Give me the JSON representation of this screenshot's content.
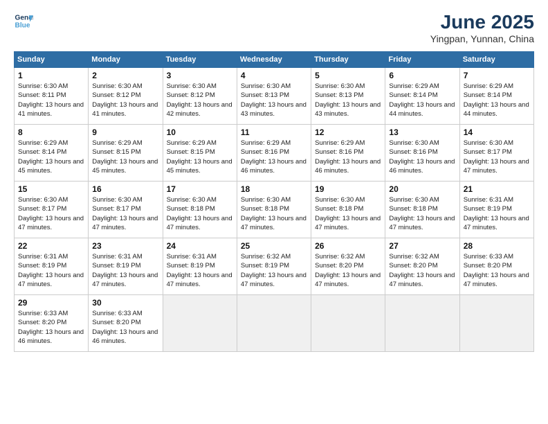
{
  "header": {
    "logo_line1": "General",
    "logo_line2": "Blue",
    "main_title": "June 2025",
    "subtitle": "Yingpan, Yunnan, China"
  },
  "calendar": {
    "days_of_week": [
      "Sunday",
      "Monday",
      "Tuesday",
      "Wednesday",
      "Thursday",
      "Friday",
      "Saturday"
    ],
    "weeks": [
      [
        null,
        null,
        null,
        null,
        null,
        null,
        null
      ]
    ],
    "cells": [
      {
        "day": 1,
        "sunrise": "6:30 AM",
        "sunset": "8:11 PM",
        "daylight": "13 hours and 41 minutes."
      },
      {
        "day": 2,
        "sunrise": "6:30 AM",
        "sunset": "8:12 PM",
        "daylight": "13 hours and 41 minutes."
      },
      {
        "day": 3,
        "sunrise": "6:30 AM",
        "sunset": "8:12 PM",
        "daylight": "13 hours and 42 minutes."
      },
      {
        "day": 4,
        "sunrise": "6:30 AM",
        "sunset": "8:13 PM",
        "daylight": "13 hours and 43 minutes."
      },
      {
        "day": 5,
        "sunrise": "6:30 AM",
        "sunset": "8:13 PM",
        "daylight": "13 hours and 43 minutes."
      },
      {
        "day": 6,
        "sunrise": "6:29 AM",
        "sunset": "8:14 PM",
        "daylight": "13 hours and 44 minutes."
      },
      {
        "day": 7,
        "sunrise": "6:29 AM",
        "sunset": "8:14 PM",
        "daylight": "13 hours and 44 minutes."
      },
      {
        "day": 8,
        "sunrise": "6:29 AM",
        "sunset": "8:14 PM",
        "daylight": "13 hours and 45 minutes."
      },
      {
        "day": 9,
        "sunrise": "6:29 AM",
        "sunset": "8:15 PM",
        "daylight": "13 hours and 45 minutes."
      },
      {
        "day": 10,
        "sunrise": "6:29 AM",
        "sunset": "8:15 PM",
        "daylight": "13 hours and 45 minutes."
      },
      {
        "day": 11,
        "sunrise": "6:29 AM",
        "sunset": "8:16 PM",
        "daylight": "13 hours and 46 minutes."
      },
      {
        "day": 12,
        "sunrise": "6:29 AM",
        "sunset": "8:16 PM",
        "daylight": "13 hours and 46 minutes."
      },
      {
        "day": 13,
        "sunrise": "6:30 AM",
        "sunset": "8:16 PM",
        "daylight": "13 hours and 46 minutes."
      },
      {
        "day": 14,
        "sunrise": "6:30 AM",
        "sunset": "8:17 PM",
        "daylight": "13 hours and 47 minutes."
      },
      {
        "day": 15,
        "sunrise": "6:30 AM",
        "sunset": "8:17 PM",
        "daylight": "13 hours and 47 minutes."
      },
      {
        "day": 16,
        "sunrise": "6:30 AM",
        "sunset": "8:17 PM",
        "daylight": "13 hours and 47 minutes."
      },
      {
        "day": 17,
        "sunrise": "6:30 AM",
        "sunset": "8:18 PM",
        "daylight": "13 hours and 47 minutes."
      },
      {
        "day": 18,
        "sunrise": "6:30 AM",
        "sunset": "8:18 PM",
        "daylight": "13 hours and 47 minutes."
      },
      {
        "day": 19,
        "sunrise": "6:30 AM",
        "sunset": "8:18 PM",
        "daylight": "13 hours and 47 minutes."
      },
      {
        "day": 20,
        "sunrise": "6:30 AM",
        "sunset": "8:18 PM",
        "daylight": "13 hours and 47 minutes."
      },
      {
        "day": 21,
        "sunrise": "6:31 AM",
        "sunset": "8:19 PM",
        "daylight": "13 hours and 47 minutes."
      },
      {
        "day": 22,
        "sunrise": "6:31 AM",
        "sunset": "8:19 PM",
        "daylight": "13 hours and 47 minutes."
      },
      {
        "day": 23,
        "sunrise": "6:31 AM",
        "sunset": "8:19 PM",
        "daylight": "13 hours and 47 minutes."
      },
      {
        "day": 24,
        "sunrise": "6:31 AM",
        "sunset": "8:19 PM",
        "daylight": "13 hours and 47 minutes."
      },
      {
        "day": 25,
        "sunrise": "6:32 AM",
        "sunset": "8:19 PM",
        "daylight": "13 hours and 47 minutes."
      },
      {
        "day": 26,
        "sunrise": "6:32 AM",
        "sunset": "8:20 PM",
        "daylight": "13 hours and 47 minutes."
      },
      {
        "day": 27,
        "sunrise": "6:32 AM",
        "sunset": "8:20 PM",
        "daylight": "13 hours and 47 minutes."
      },
      {
        "day": 28,
        "sunrise": "6:33 AM",
        "sunset": "8:20 PM",
        "daylight": "13 hours and 47 minutes."
      },
      {
        "day": 29,
        "sunrise": "6:33 AM",
        "sunset": "8:20 PM",
        "daylight": "13 hours and 46 minutes."
      },
      {
        "day": 30,
        "sunrise": "6:33 AM",
        "sunset": "8:20 PM",
        "daylight": "13 hours and 46 minutes."
      }
    ]
  }
}
